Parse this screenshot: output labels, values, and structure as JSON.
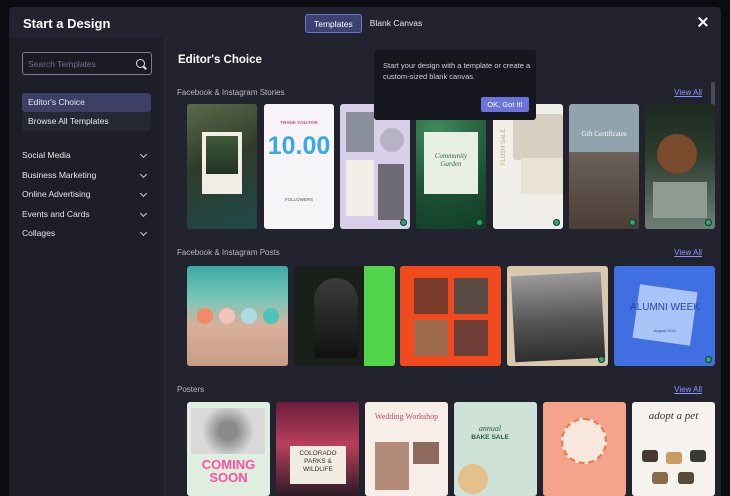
{
  "header": {
    "title": "Start a Design",
    "tabs": [
      {
        "label": "Templates",
        "active": true
      },
      {
        "label": "Blank Canvas",
        "active": false
      }
    ]
  },
  "tooltip": {
    "text": "Start your design with a template or create a custom-sized blank canvas.",
    "button": "OK, Got It!"
  },
  "sidebar": {
    "search_placeholder": "Search Templates",
    "pills": [
      {
        "label": "Editor's Choice",
        "active": true
      },
      {
        "label": "Browse All Templates",
        "active": false
      }
    ],
    "categories": [
      "Social Media",
      "Business Marketing",
      "Online Advertising",
      "Events and Cards",
      "Collages"
    ]
  },
  "main": {
    "title": "Editor's Choice",
    "sections": [
      {
        "title": "Facebook & Instagram Stories",
        "view_all": "View All"
      },
      {
        "title": "Facebook & Instagram Posts",
        "view_all": "View All"
      },
      {
        "title": "Posters",
        "view_all": "View All"
      }
    ]
  },
  "thumb_text": {
    "thanks_top": "THANK YOU FOR",
    "thanks_num": "10.00",
    "thanks_bottom": "FOLLOWERS",
    "community": "Community Garden",
    "flush": "FLUSH SALE",
    "gift": "Gift Certificates",
    "alumni": "ALUMNI WEEK",
    "alumni_date": "August 2022",
    "coming": "COMING SOON",
    "colorado": "COLORADO PARKS & WILDLIFE",
    "wedding": "Wedding Workshop",
    "bake_a": "annual",
    "bake_b": "BAKE SALE",
    "adopt": "adopt a pet"
  },
  "colors": {
    "accent": "#6b74d8",
    "link": "#8e95ff",
    "badge": "#2ea66f"
  }
}
